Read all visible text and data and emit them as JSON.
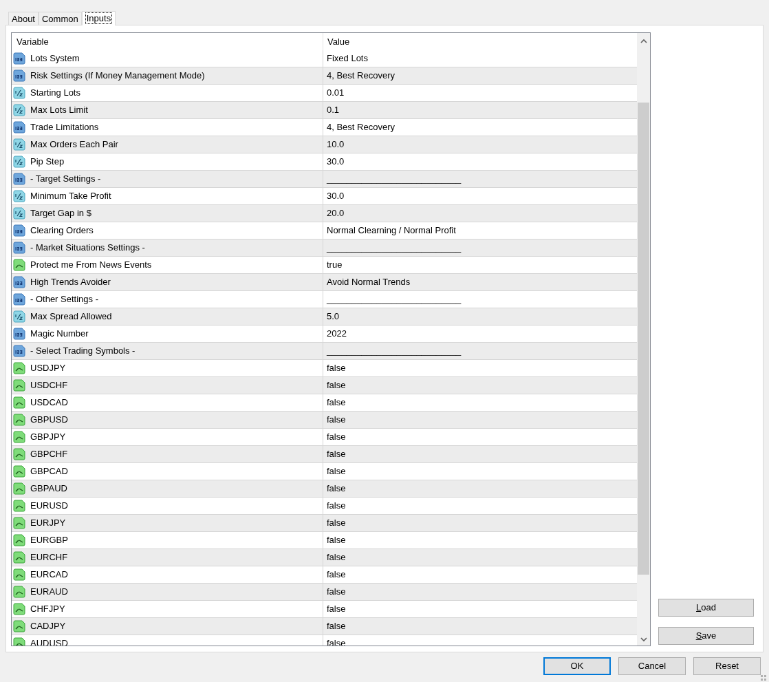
{
  "tabs": [
    {
      "label": "About",
      "selected": false
    },
    {
      "label": "Common",
      "selected": false
    },
    {
      "label": "Inputs",
      "selected": true
    }
  ],
  "table": {
    "columns": [
      "Variable",
      "Value"
    ],
    "rows": [
      {
        "kind": "int",
        "variable": "Lots System",
        "value": "Fixed Lots"
      },
      {
        "kind": "int",
        "variable": "Risk Settings (If Money Management Mode)",
        "value": "4, Best Recovery"
      },
      {
        "kind": "double",
        "variable": "Starting Lots",
        "value": "0.01"
      },
      {
        "kind": "double",
        "variable": "Max Lots Limit",
        "value": "0.1"
      },
      {
        "kind": "int",
        "variable": "Trade Limitations",
        "value": "4, Best Recovery"
      },
      {
        "kind": "double",
        "variable": "Max Orders Each Pair",
        "value": "10.0"
      },
      {
        "kind": "double",
        "variable": "Pip Step",
        "value": "30.0"
      },
      {
        "kind": "int",
        "variable": "- Target Settings -",
        "value": "___________________________"
      },
      {
        "kind": "double",
        "variable": "Minimum Take Profit",
        "value": "30.0"
      },
      {
        "kind": "double",
        "variable": "Target Gap in $",
        "value": "20.0"
      },
      {
        "kind": "int",
        "variable": "Clearing Orders",
        "value": "Normal Clearning / Normal Profit"
      },
      {
        "kind": "int",
        "variable": "- Market Situations Settings -",
        "value": "___________________________"
      },
      {
        "kind": "bool",
        "variable": "Protect me From News Events",
        "value": "true"
      },
      {
        "kind": "int",
        "variable": "High Trends Avoider",
        "value": "Avoid Normal Trends"
      },
      {
        "kind": "int",
        "variable": "- Other Settings -",
        "value": "___________________________"
      },
      {
        "kind": "double",
        "variable": "Max Spread Allowed",
        "value": "5.0"
      },
      {
        "kind": "int",
        "variable": "Magic Number",
        "value": "2022"
      },
      {
        "kind": "int",
        "variable": "- Select Trading Symbols -",
        "value": "___________________________"
      },
      {
        "kind": "bool",
        "variable": "USDJPY",
        "value": "false"
      },
      {
        "kind": "bool",
        "variable": "USDCHF",
        "value": "false"
      },
      {
        "kind": "bool",
        "variable": "USDCAD",
        "value": "false"
      },
      {
        "kind": "bool",
        "variable": "GBPUSD",
        "value": "false"
      },
      {
        "kind": "bool",
        "variable": "GBPJPY",
        "value": "false"
      },
      {
        "kind": "bool",
        "variable": "GBPCHF",
        "value": "false"
      },
      {
        "kind": "bool",
        "variable": "GBPCAD",
        "value": "false"
      },
      {
        "kind": "bool",
        "variable": "GBPAUD",
        "value": "false"
      },
      {
        "kind": "bool",
        "variable": "EURUSD",
        "value": "false"
      },
      {
        "kind": "bool",
        "variable": "EURJPY",
        "value": "false"
      },
      {
        "kind": "bool",
        "variable": "EURGBP",
        "value": "false"
      },
      {
        "kind": "bool",
        "variable": "EURCHF",
        "value": "false"
      },
      {
        "kind": "bool",
        "variable": "EURCAD",
        "value": "false"
      },
      {
        "kind": "bool",
        "variable": "EURAUD",
        "value": "false"
      },
      {
        "kind": "bool",
        "variable": "CHFJPY",
        "value": "false"
      },
      {
        "kind": "bool",
        "variable": "CADJPY",
        "value": "false"
      },
      {
        "kind": "bool",
        "variable": "AUDUSD",
        "value": "false"
      }
    ]
  },
  "side_buttons": [
    "Load",
    "Save"
  ],
  "buttons": [
    {
      "label": "OK",
      "default": true
    },
    {
      "label": "Cancel",
      "default": false
    },
    {
      "label": "Reset",
      "default": false
    }
  ]
}
